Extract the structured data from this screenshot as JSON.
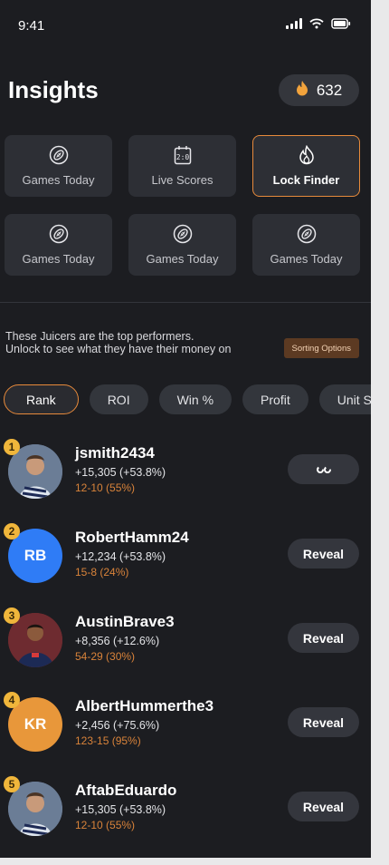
{
  "status_bar": {
    "time": "9:41"
  },
  "header": {
    "title": "Insights",
    "points": "632"
  },
  "tiles": [
    {
      "label": "Games Today",
      "icon": "football-icon"
    },
    {
      "label": "Live Scores",
      "icon": "scoreboard-icon"
    },
    {
      "label": "Lock Finder",
      "icon": "flame-icon",
      "active": true
    },
    {
      "label": "Games Today",
      "icon": "football-icon"
    },
    {
      "label": "Games Today",
      "icon": "football-icon"
    },
    {
      "label": "Games Today",
      "icon": "football-icon"
    }
  ],
  "info": {
    "line1": "These Juicers are the top performers.",
    "line2": "Unlock to see what they have their money on",
    "sort_button": "Sorting Options"
  },
  "chips": [
    "Rank",
    "ROI",
    "Win %",
    "Profit",
    "Unit Size"
  ],
  "performers": [
    {
      "rank": "1",
      "username": "jsmith2434",
      "profit": "+15,305 (+53.8%)",
      "record": "12-10 (55%)",
      "action": "",
      "avatar": "photo",
      "avatar_color": "#5b6b86"
    },
    {
      "rank": "2",
      "username": "RobertHamm24",
      "profit": "+12,234 (+53.8%)",
      "record": "15-8 (24%)",
      "action": "Reveal",
      "initials": "RB",
      "avatar_color": "#2f7cf6"
    },
    {
      "rank": "3",
      "username": "AustinBrave3",
      "profit": "+8,356 (+12.6%)",
      "record": "54-29 (30%)",
      "action": "Reveal",
      "avatar": "photo",
      "avatar_color": "#7a2a2a"
    },
    {
      "rank": "4",
      "username": "AlbertHummerthe3",
      "profit": "+2,456 (+75.6%)",
      "record": "123-15 (95%)",
      "action": "Reveal",
      "initials": "KR",
      "avatar_color": "#e8973a"
    },
    {
      "rank": "5",
      "username": "AftabEduardo",
      "profit": "+15,305 (+53.8%)",
      "record": "12-10 (55%)",
      "action": "Reveal",
      "avatar": "photo",
      "avatar_color": "#5b6b86"
    }
  ],
  "colors": {
    "accent": "#e78a3b",
    "background": "#1c1d21",
    "card": "#2d2f35"
  }
}
